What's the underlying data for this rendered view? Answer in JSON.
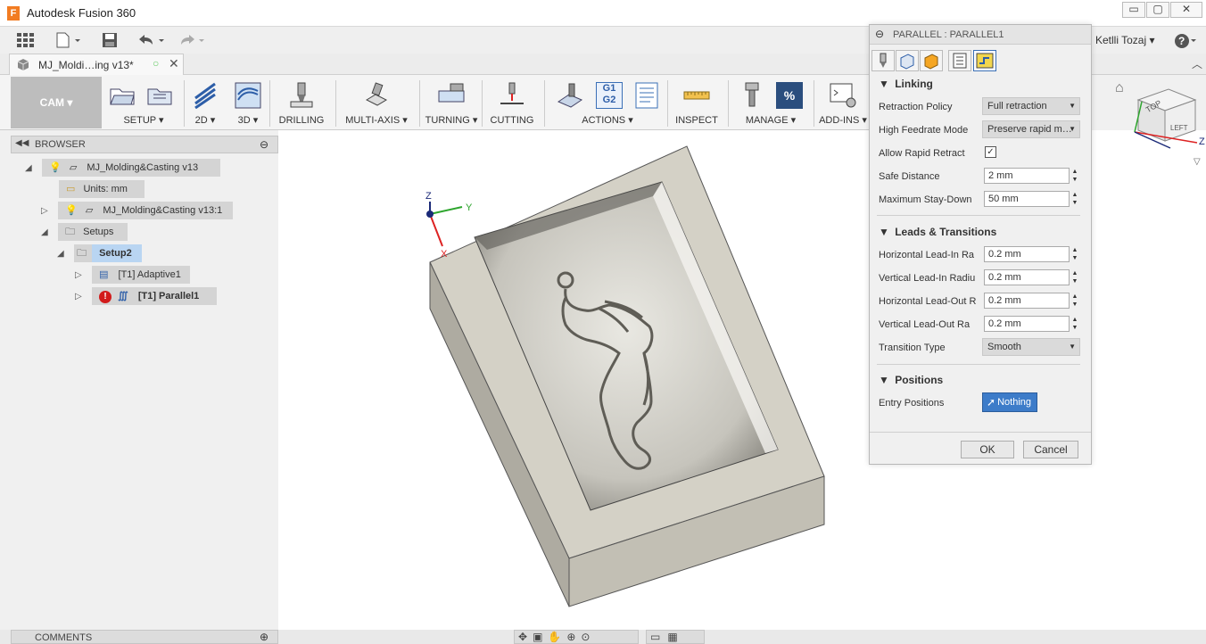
{
  "app": {
    "title": "Autodesk Fusion 360",
    "logo_letter": "F"
  },
  "window_controls": {
    "minimize": "▭",
    "maximize": "▢",
    "close": "✕"
  },
  "user": {
    "name": "Ketlli Tozaj",
    "help": "?"
  },
  "document_tab": {
    "label": "MJ_Moldi…ing v13*"
  },
  "ribbon": {
    "workspace": "CAM",
    "groups": [
      {
        "label": "SETUP ▾"
      },
      {
        "label": "2D ▾"
      },
      {
        "label": "3D ▾"
      },
      {
        "label": "DRILLING"
      },
      {
        "label": "MULTI-AXIS ▾"
      },
      {
        "label": "TURNING ▾"
      },
      {
        "label": "CUTTING"
      },
      {
        "label": "ACTIONS ▾"
      },
      {
        "label": "INSPECT"
      },
      {
        "label": "MANAGE ▾"
      },
      {
        "label": "ADD-INS ▾"
      }
    ],
    "actions_g1": "G1",
    "actions_g2": "G2",
    "manage_percent": "%"
  },
  "browser": {
    "title": "BROWSER",
    "items": [
      {
        "label": "MJ_Molding&Casting v13"
      },
      {
        "label": "Units: mm"
      },
      {
        "label": "MJ_Molding&Casting v13:1"
      },
      {
        "label": "Setups"
      },
      {
        "label": "Setup2"
      },
      {
        "label": "[T1] Adaptive1"
      },
      {
        "label": "[T1] Parallel1"
      }
    ]
  },
  "comments": {
    "title": "COMMENTS"
  },
  "viewcube": {
    "top": "TOP",
    "left": "LEFT",
    "axis_z": "Z",
    "axis_x": "X",
    "axis_y": "Y"
  },
  "dialog": {
    "title": "PARALLEL : PARALLEL1",
    "linking": {
      "header": "Linking",
      "retraction_policy_label": "Retraction Policy",
      "retraction_policy_value": "Full retraction",
      "high_feedrate_label": "High Feedrate Mode",
      "high_feedrate_value": "Preserve rapid m…",
      "allow_rapid_label": "Allow Rapid Retract",
      "allow_rapid_checked": "✓",
      "safe_distance_label": "Safe Distance",
      "safe_distance_value": "2 mm",
      "max_stay_label": "Maximum Stay-Down",
      "max_stay_value": "50 mm"
    },
    "leads": {
      "header": "Leads & Transitions",
      "h_lead_in_label": "Horizontal Lead-In Ra",
      "h_lead_in_value": "0.2 mm",
      "v_lead_in_label": "Vertical Lead-In Radiu",
      "v_lead_in_value": "0.2 mm",
      "h_lead_out_label": "Horizontal Lead-Out R",
      "h_lead_out_value": "0.2 mm",
      "v_lead_out_label": "Vertical Lead-Out Ra",
      "v_lead_out_value": "0.2 mm",
      "transition_label": "Transition Type",
      "transition_value": "Smooth"
    },
    "positions": {
      "header": "Positions",
      "entry_label": "Entry Positions",
      "entry_value": "Nothing"
    },
    "ok": "OK",
    "cancel": "Cancel"
  },
  "axes": {
    "z": "Z",
    "x": "X",
    "y": "Y"
  }
}
